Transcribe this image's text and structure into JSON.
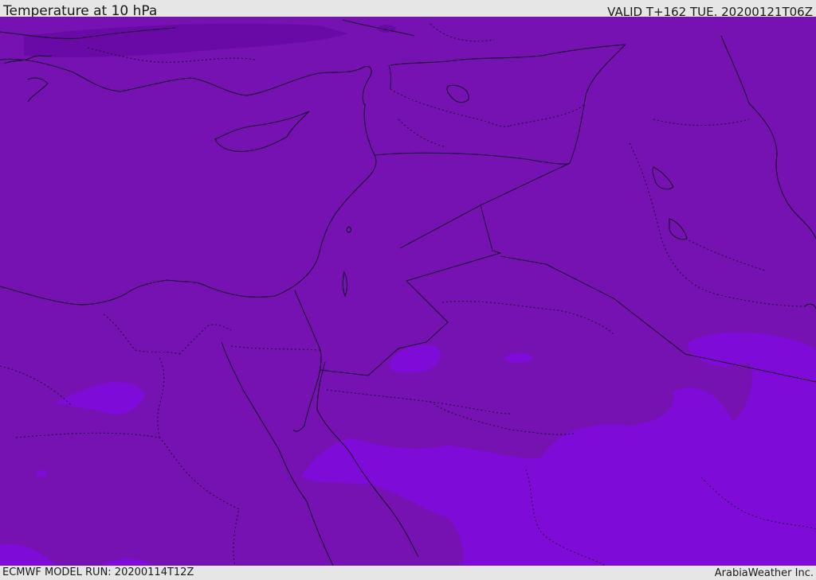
{
  "header": {
    "title": "Temperature at 10 hPa",
    "valid": "VALID T+162 TUE. 20200121T06Z"
  },
  "footer": {
    "model_run": "ECMWF MODEL RUN: 20200114T12Z",
    "credit": "ArabiaWeather Inc."
  },
  "colors": {
    "base": "#7612b2",
    "cold_band": "#6a0aa6",
    "warm_zone": "#7f0bd8",
    "border": "#1a0530",
    "bar": "#e6e6e6"
  }
}
